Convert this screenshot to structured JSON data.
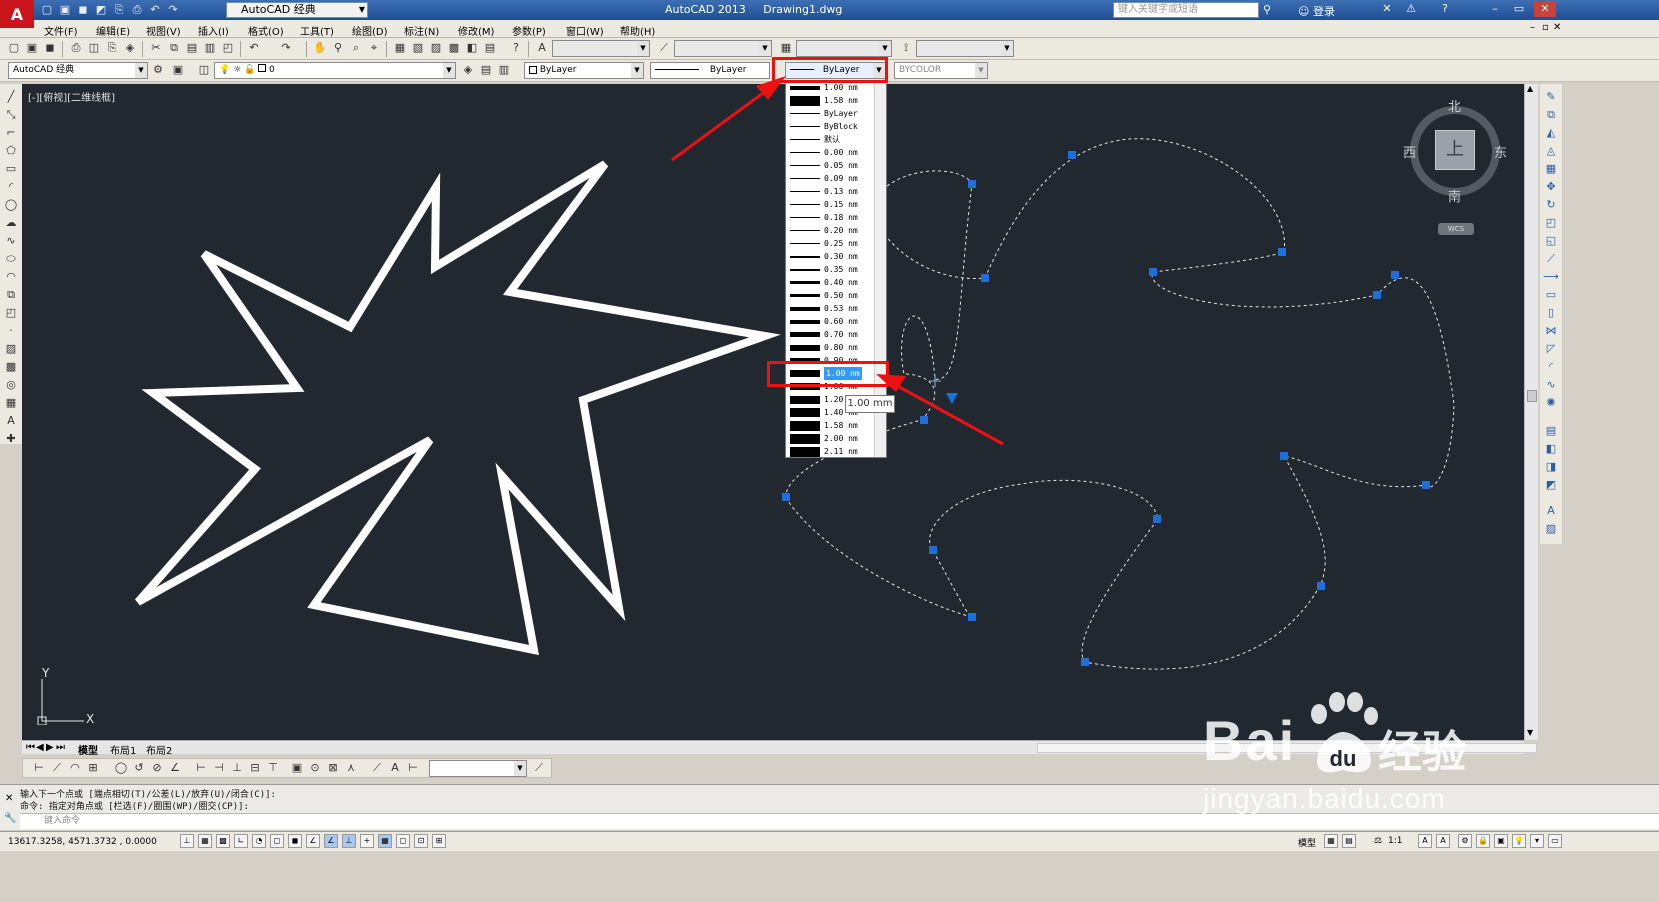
{
  "titlebar": {
    "workspace": "AutoCAD 经典",
    "app_name": "AutoCAD 2013",
    "doc_name": "Drawing1.dwg",
    "search_placeholder": "键入关键字或短语",
    "login": "登录"
  },
  "menubar": {
    "items": [
      "文件(F)",
      "编辑(E)",
      "视图(V)",
      "插入(I)",
      "格式(O)",
      "工具(T)",
      "绘图(D)",
      "标注(N)",
      "修改(M)",
      "参数(P)",
      "窗口(W)",
      "帮助(H)"
    ]
  },
  "toolbar2": {
    "workspace": "AutoCAD 经典",
    "layer": "0",
    "color": "ByLayer",
    "linetype": "ByLayer",
    "lineweight": "ByLayer",
    "plotstyle": "BYCOLOR"
  },
  "canvas": {
    "view_label": "[-][俯视][二维线框]",
    "background": "#212830"
  },
  "viewcube": {
    "north": "北",
    "south": "南",
    "east": "东",
    "west": "西",
    "face": "上",
    "wcs": "WCS"
  },
  "ucs": {
    "x": "X",
    "y": "Y"
  },
  "lineweight_list": {
    "items": [
      {
        "label": "1.00 nm",
        "w": 4
      },
      {
        "label": "1.58 nm",
        "w": 10
      },
      {
        "label": "ByLayer",
        "w": 1
      },
      {
        "label": "ByBlock",
        "w": 1
      },
      {
        "label": "默认",
        "w": 1
      },
      {
        "label": "0.00 nm",
        "w": 1
      },
      {
        "label": "0.05 nm",
        "w": 1
      },
      {
        "label": "0.09 nm",
        "w": 1
      },
      {
        "label": "0.13 nm",
        "w": 1
      },
      {
        "label": "0.15 nm",
        "w": 1
      },
      {
        "label": "0.18 nm",
        "w": 1
      },
      {
        "label": "0.20 nm",
        "w": 1
      },
      {
        "label": "0.25 nm",
        "w": 1
      },
      {
        "label": "0.30 nm",
        "w": 2
      },
      {
        "label": "0.35 nm",
        "w": 2
      },
      {
        "label": "0.40 nm",
        "w": 3
      },
      {
        "label": "0.50 nm",
        "w": 3
      },
      {
        "label": "0.53 nm",
        "w": 4
      },
      {
        "label": "0.60 nm",
        "w": 4
      },
      {
        "label": "0.70 nm",
        "w": 5
      },
      {
        "label": "0.80 nm",
        "w": 6
      },
      {
        "label": "0.90 nm",
        "w": 6
      },
      {
        "label": "1.00 nm",
        "w": 7,
        "selected": true
      },
      {
        "label": "1.06 nm",
        "w": 7
      },
      {
        "label": "1.20 nm",
        "w": 8
      },
      {
        "label": "1.40 nm",
        "w": 9
      },
      {
        "label": "1.58 nm",
        "w": 10
      },
      {
        "label": "2.00 nm",
        "w": 10
      },
      {
        "label": "2.11 nm",
        "w": 10
      }
    ],
    "tooltip": "1.00 mm"
  },
  "tabs": [
    "模型",
    "布局1",
    "布局2"
  ],
  "command": {
    "line1": "输入下一个点或 [端点相切(T)/公差(L)/放弃(U)/闭合(C)]:",
    "line2": "命令: 指定对角点或 [栏选(F)/圈围(WP)/圈交(CP)]:",
    "input_placeholder": "键入命令"
  },
  "statusbar": {
    "coords": "13617.3258, 4571.3732 , 0.0000",
    "model": "模型",
    "scale": "1:1"
  },
  "watermark": {
    "brand": "Bai",
    "brand2": "经验",
    "url": "jingyan.baidu.com"
  }
}
